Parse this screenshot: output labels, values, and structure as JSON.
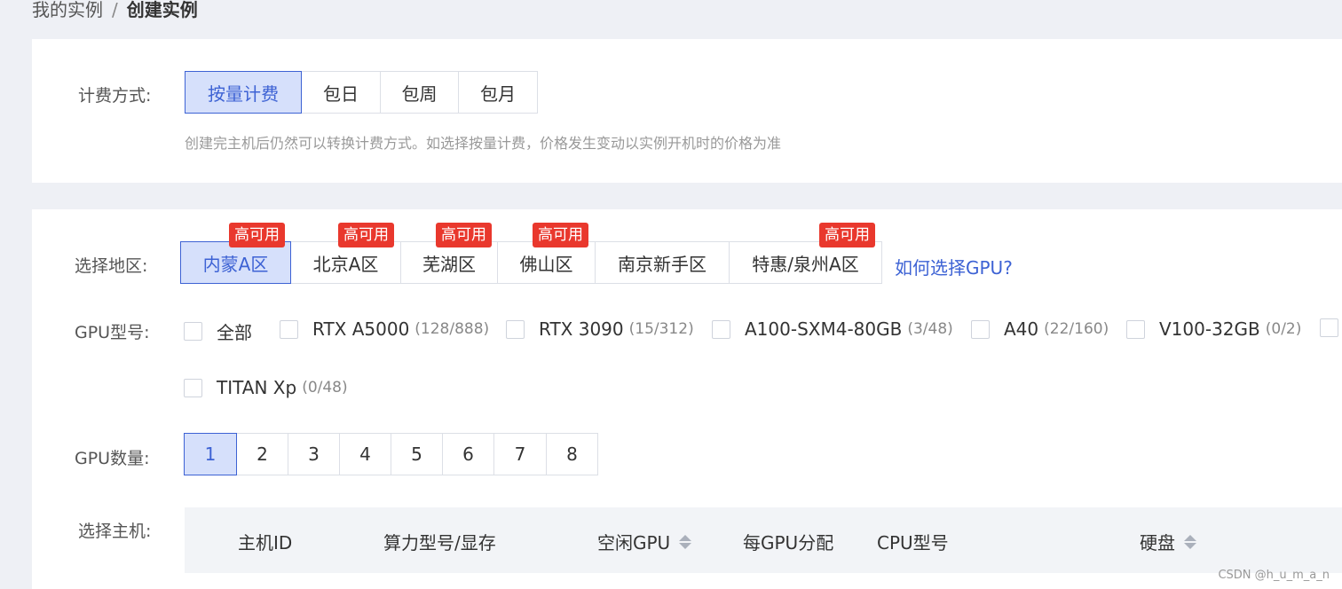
{
  "breadcrumb": {
    "parent": "我的实例",
    "separator": "/",
    "current": "创建实例"
  },
  "billing": {
    "label": "计费方式:",
    "options": [
      "按量计费",
      "包日",
      "包周",
      "包月"
    ],
    "selected": "按量计费",
    "hint": "创建完主机后仍然可以转换计费方式。如选择按量计费，价格发生变动以实例开机时的价格为准"
  },
  "region": {
    "label": "选择地区:",
    "options": [
      {
        "name": "内蒙A区",
        "badge": "高可用"
      },
      {
        "name": "北京A区",
        "badge": "高可用"
      },
      {
        "name": "芜湖区",
        "badge": "高可用"
      },
      {
        "name": "佛山区",
        "badge": "高可用"
      },
      {
        "name": "南京新手区",
        "badge": ""
      },
      {
        "name": "特惠/泉州A区",
        "badge": "高可用"
      }
    ],
    "selected": "内蒙A区",
    "help_link": "如何选择GPU?"
  },
  "gpu_model": {
    "label": "GPU型号:",
    "options": [
      {
        "name": "全部",
        "count": ""
      },
      {
        "name": "RTX A5000",
        "count": "(128/888)"
      },
      {
        "name": "RTX 3090",
        "count": "(15/312)"
      },
      {
        "name": "A100-SXM4-80GB",
        "count": "(3/48)"
      },
      {
        "name": "A40",
        "count": "(22/160)"
      },
      {
        "name": "V100-32GB",
        "count": "(0/2)"
      },
      {
        "name": "",
        "count": ""
      },
      {
        "name": "TITAN Xp",
        "count": "(0/48)"
      }
    ]
  },
  "gpu_count": {
    "label": "GPU数量:",
    "options": [
      "1",
      "2",
      "3",
      "4",
      "5",
      "6",
      "7",
      "8"
    ],
    "selected": "1"
  },
  "host": {
    "label": "选择主机:",
    "columns": [
      "主机ID",
      "算力型号/显存",
      "空闲GPU",
      "每GPU分配",
      "CPU型号",
      "硬盘"
    ]
  },
  "watermark": "CSDN @h_u_m_a_n"
}
